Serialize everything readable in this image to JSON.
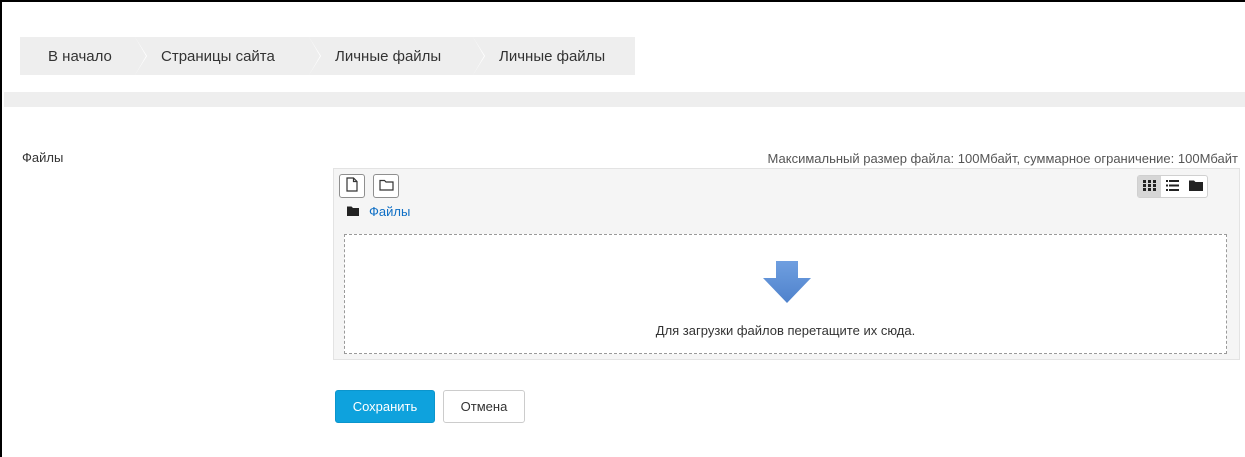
{
  "breadcrumb": {
    "items": [
      {
        "label": "В начало"
      },
      {
        "label": "Страницы сайта"
      },
      {
        "label": "Личные файлы"
      },
      {
        "label": "Личные файлы"
      }
    ]
  },
  "form": {
    "files_label": "Файлы"
  },
  "filemanager": {
    "limits_text": "Максимальный размер файла: 100Мбайт, суммарное ограничение: 100Мбайт",
    "add_file_icon": "file-icon",
    "create_folder_icon": "folder-outline-icon",
    "views": [
      {
        "icon": "grid-icon",
        "active": true
      },
      {
        "icon": "list-icon",
        "active": false
      },
      {
        "icon": "folder-tree-icon",
        "active": false
      }
    ],
    "path_label": "Файлы",
    "dropzone_text": "Для загрузки файлов перетащите их сюда."
  },
  "actions": {
    "save_label": "Сохранить",
    "cancel_label": "Отмена"
  },
  "colors": {
    "primary": "#0ea2dd",
    "link": "#0f6fc5",
    "arrow": "#5b8fd6"
  }
}
